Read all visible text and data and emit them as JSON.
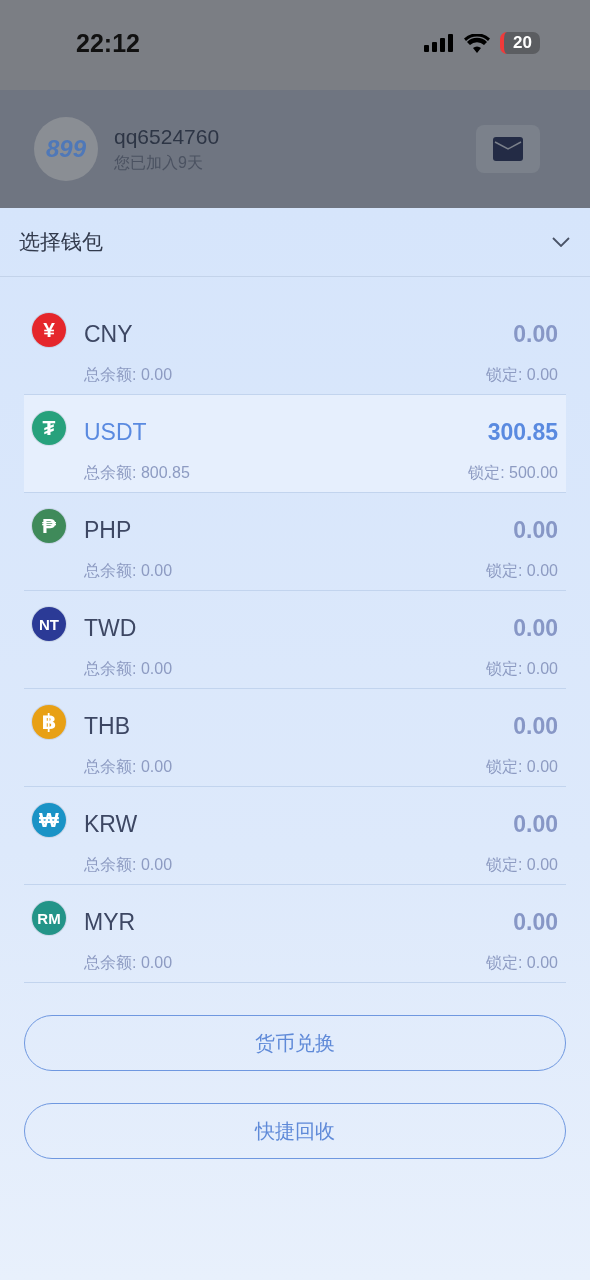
{
  "status_bar": {
    "time": "22:12",
    "battery": "20"
  },
  "profile": {
    "logo": "899",
    "username": "qq6524760",
    "joined": "您已加入9天"
  },
  "sheet": {
    "title": "选择钱包",
    "expanded": true
  },
  "wallets": [
    {
      "symbol": "¥",
      "color": "#e5262b",
      "code": "CNY",
      "amount": "0.00",
      "total": "总余额: 0.00",
      "locked": "锁定: 0.00",
      "selected": false
    },
    {
      "symbol": "₮",
      "color": "#27a17c",
      "code": "USDT",
      "amount": "300.85",
      "total": "总余额: 800.85",
      "locked": "锁定: 500.00",
      "selected": true
    },
    {
      "symbol": "₱",
      "color": "#3f8a5a",
      "code": "PHP",
      "amount": "0.00",
      "total": "总余额: 0.00",
      "locked": "锁定: 0.00",
      "selected": false
    },
    {
      "symbol": "NT",
      "color": "#2b3a96",
      "code": "TWD",
      "amount": "0.00",
      "total": "总余额: 0.00",
      "locked": "锁定: 0.00",
      "selected": false
    },
    {
      "symbol": "฿",
      "color": "#e8a015",
      "code": "THB",
      "amount": "0.00",
      "total": "总余额: 0.00",
      "locked": "锁定: 0.00",
      "selected": false
    },
    {
      "symbol": "₩",
      "color": "#1a93c6",
      "code": "KRW",
      "amount": "0.00",
      "total": "总余额: 0.00",
      "locked": "锁定: 0.00",
      "selected": false
    },
    {
      "symbol": "RM",
      "color": "#239488",
      "code": "MYR",
      "amount": "0.00",
      "total": "总余额: 0.00",
      "locked": "锁定: 0.00",
      "selected": false
    }
  ],
  "buttons": [
    "货币兑换",
    "快捷回收"
  ]
}
